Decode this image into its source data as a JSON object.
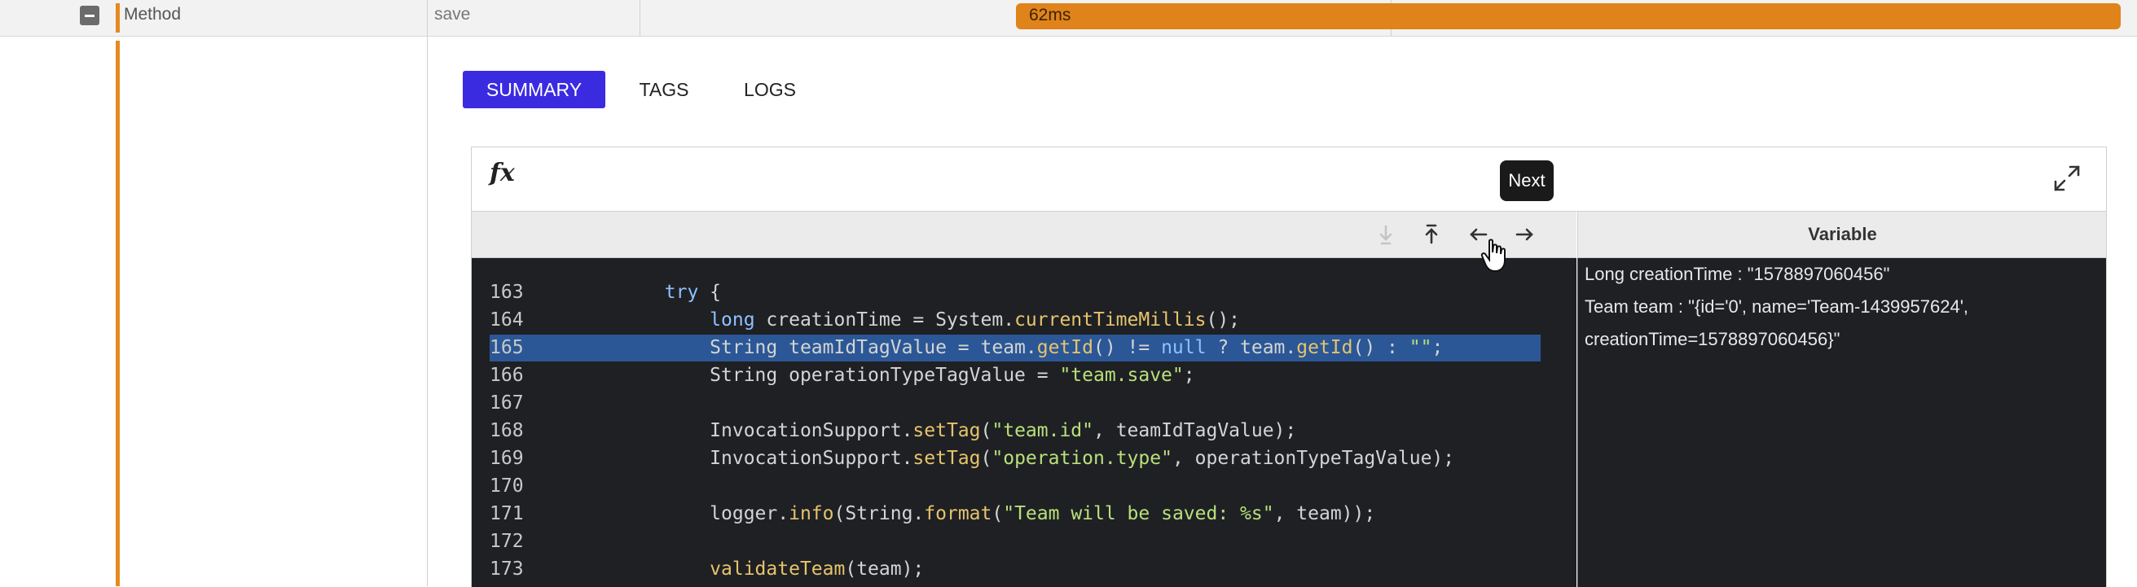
{
  "trace_row": {
    "type_label": "Method",
    "name": "save",
    "duration": "62ms"
  },
  "tabs": [
    {
      "label": "SUMMARY",
      "active": true
    },
    {
      "label": "TAGS",
      "active": false
    },
    {
      "label": "LOGS",
      "active": false
    }
  ],
  "debugger": {
    "fx_label": "fx",
    "tooltip": "Next",
    "toolbar_icons": [
      "step-into-icon",
      "step-out-icon",
      "previous-arrow-icon",
      "next-arrow-icon"
    ],
    "variables_header": "Variable",
    "highlighted_line": "165",
    "code_lines": [
      {
        "num": "163",
        "text": "        try {"
      },
      {
        "num": "164",
        "text": "            long creationTime = System.currentTimeMillis();"
      },
      {
        "num": "165",
        "text": "            String teamIdTagValue = team.getId() != null ? team.getId() : \"\";"
      },
      {
        "num": "166",
        "text": "            String operationTypeTagValue = \"team.save\";"
      },
      {
        "num": "167",
        "text": ""
      },
      {
        "num": "168",
        "text": "            InvocationSupport.setTag(\"team.id\", teamIdTagValue);"
      },
      {
        "num": "169",
        "text": "            InvocationSupport.setTag(\"operation.type\", operationTypeTagValue);"
      },
      {
        "num": "170",
        "text": ""
      },
      {
        "num": "171",
        "text": "            logger.info(String.format(\"Team will be saved: %s\", team));"
      },
      {
        "num": "172",
        "text": ""
      },
      {
        "num": "173",
        "text": "            validateTeam(team);"
      }
    ],
    "variables": [
      "Long creationTime : \"1578897060456\"",
      "Team team : \"{id='0', name='Team-1439957624',",
      "creationTime=1578897060456}\""
    ]
  },
  "colors": {
    "accent_orange": "#e0831a",
    "active_tab": "#3b2be0",
    "code_bg": "#1f2024",
    "highlight": "#2b5796"
  }
}
